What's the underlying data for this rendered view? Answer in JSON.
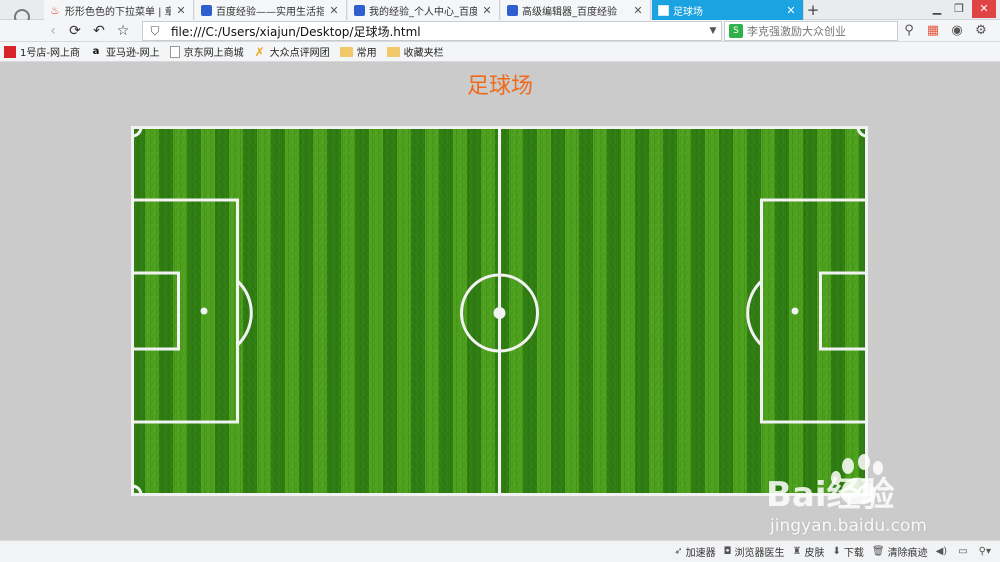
{
  "tabs": [
    {
      "label": "形形色色的下拉菜单 | 章节",
      "icon": "flame-icon",
      "active": false
    },
    {
      "label": "百度经验——实用生活指南",
      "icon": "baidu-paw-icon",
      "active": false
    },
    {
      "label": "我的经验_个人中心_百度经验",
      "icon": "baidu-paw-icon",
      "active": false
    },
    {
      "label": "高级编辑器_百度经验",
      "icon": "baidu-paw-icon",
      "active": false
    },
    {
      "label": "足球场",
      "icon": "page-icon",
      "active": true
    }
  ],
  "address_bar": {
    "url": "file:///C:/Users/xiajun/Desktop/足球场.html"
  },
  "search_box": {
    "query": "李克强激励大众创业"
  },
  "bookmarks": [
    {
      "label": "1号店-网上商",
      "icon": "yhd-icon"
    },
    {
      "label": "亚马逊-网上",
      "icon": "amazon-icon"
    },
    {
      "label": "京东网上商城",
      "icon": "page-icon"
    },
    {
      "label": "大众点评网团",
      "icon": "dianping-icon"
    },
    {
      "label": "常用",
      "icon": "folder-icon"
    },
    {
      "label": "收藏夹栏",
      "icon": "folder-icon"
    }
  ],
  "page": {
    "title": "足球场"
  },
  "watermark": {
    "text": "jingyan.baidu.com",
    "logo_text": "Bai经验"
  },
  "status_bar": [
    {
      "label": "加速器",
      "icon": "rocket-icon"
    },
    {
      "label": "浏览器医生",
      "icon": "camera-icon"
    },
    {
      "label": "皮肤",
      "icon": "shirt-icon"
    },
    {
      "label": "下载",
      "icon": "download-icon"
    },
    {
      "label": "清除痕迹",
      "icon": "trash-icon"
    }
  ],
  "colors": {
    "accent_tab": "#1aa3e0",
    "title": "#ef6a1b",
    "grass_dark": "#2f7d12",
    "grass_light": "#4ea21e",
    "lines": "#f2f2f2"
  }
}
